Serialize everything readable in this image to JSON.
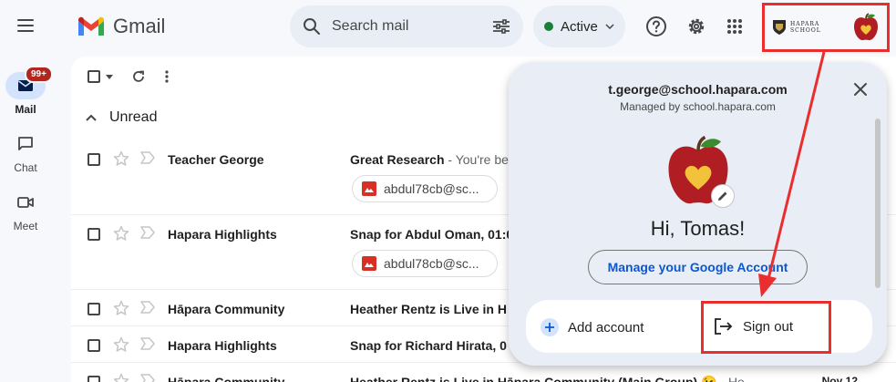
{
  "app": {
    "name": "Gmail"
  },
  "rail": {
    "items": [
      {
        "label": "Mail",
        "badge": "99+",
        "icon": "mail-icon"
      },
      {
        "label": "Chat",
        "icon": "chat-icon"
      },
      {
        "label": "Meet",
        "icon": "video-icon"
      }
    ]
  },
  "search": {
    "placeholder": "Search mail"
  },
  "status": {
    "label": "Active",
    "color": "#188038"
  },
  "account_logo": {
    "school_text_1": "HAPARA",
    "school_text_2": "SCHOOL"
  },
  "inbox": {
    "section_label": "Unread",
    "rows": [
      {
        "sender": "Teacher George",
        "subject": "Great Research",
        "snippet": " - You're be",
        "attachment": "abdul78cb@sc..."
      },
      {
        "sender": "Hapara Highlights",
        "subject": "Snap for Abdul Oman, 01:0",
        "snippet": "",
        "attachment": "abdul78cb@sc..."
      },
      {
        "sender": "Hāpara Community",
        "subject": "Heather Rentz is Live in H",
        "snippet": ""
      },
      {
        "sender": "Hapara Highlights",
        "subject": "Snap for Richard Hirata, 0",
        "snippet": ""
      },
      {
        "sender": "Hāpara Community",
        "subject": "Heather Rentz is Live in Hāpara Community (Main Group) 😉",
        "snippet": " - He",
        "date": "Nov 12"
      }
    ]
  },
  "popup": {
    "email": "t.george@school.hapara.com",
    "managed_by": "Managed by school.hapara.com",
    "greeting": "Hi, Tomas!",
    "manage_label": "Manage your Google Account",
    "add_account_label": "Add account",
    "sign_out_label": "Sign out"
  },
  "colors": {
    "annotation": "#ea2d2d",
    "accent": "#0b57d0"
  }
}
